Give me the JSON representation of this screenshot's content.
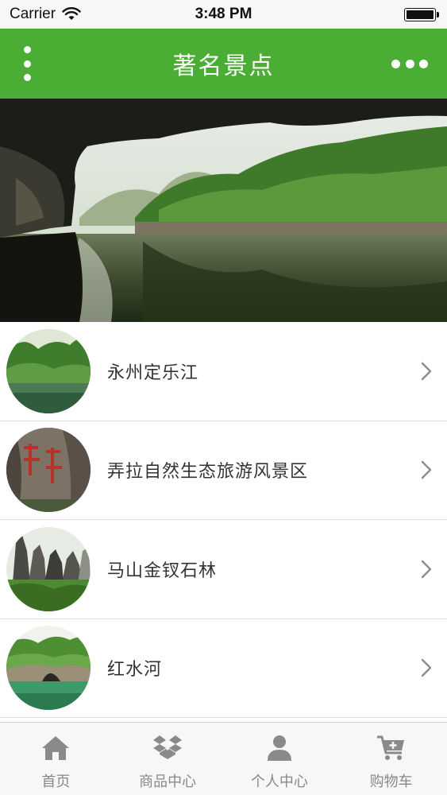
{
  "status_bar": {
    "carrier": "Carrier",
    "time": "3:48 PM"
  },
  "nav": {
    "title": "著名景点"
  },
  "hero": {
    "image": "cave-river-scenery"
  },
  "list": {
    "items": [
      {
        "label": "永州定乐江",
        "thumb": "river-forest-scenery"
      },
      {
        "label": "弄拉自然生态旅游风景区",
        "thumb": "carved-rock-scenery"
      },
      {
        "label": "马山金钗石林",
        "thumb": "karst-stone-forest-scenery"
      },
      {
        "label": "红水河",
        "thumb": "riverside-cave-scenery"
      }
    ]
  },
  "tab_bar": {
    "tabs": [
      {
        "label": "首页",
        "icon": "home-icon"
      },
      {
        "label": "商品中心",
        "icon": "dropbox-box-icon"
      },
      {
        "label": "个人中心",
        "icon": "user-icon"
      },
      {
        "label": "购物车",
        "icon": "cart-plus-icon"
      }
    ]
  },
  "colors": {
    "primary": "#4aae35",
    "tab_label": "#888888",
    "item_text": "#333333"
  }
}
